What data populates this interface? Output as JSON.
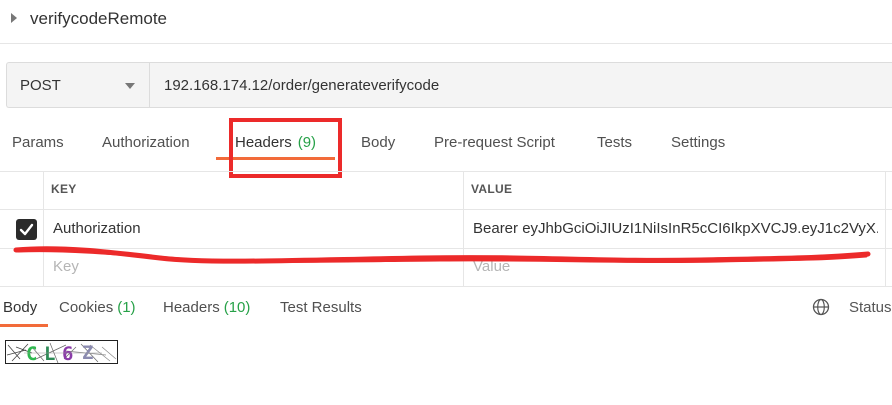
{
  "request": {
    "title": "verifycodeRemote",
    "method": "POST",
    "url": "192.168.174.12/order/generateverifycode"
  },
  "request_tabs": [
    {
      "label": "Params"
    },
    {
      "label": "Authorization"
    },
    {
      "label": "Headers",
      "count": "(9)",
      "active": true
    },
    {
      "label": "Body"
    },
    {
      "label": "Pre-request Script"
    },
    {
      "label": "Tests"
    },
    {
      "label": "Settings"
    }
  ],
  "headers_table": {
    "columns": [
      "KEY",
      "VALUE"
    ],
    "rows": [
      {
        "checked": true,
        "key": "Authorization",
        "value": "Bearer eyJhbGciOiJIUzI1NiIsInR5cCI6IkpXVCJ9.eyJ1c2VyX..."
      }
    ],
    "new_row": {
      "key_placeholder": "Key",
      "value_placeholder": "Value"
    }
  },
  "response_tabs": [
    {
      "label": "Body",
      "active": true
    },
    {
      "label": "Cookies",
      "count": "(1)"
    },
    {
      "label": "Headers",
      "count": "(10)"
    },
    {
      "label": "Test Results"
    }
  ],
  "response": {
    "status_label": "Status:",
    "captcha_text": "CL6Z"
  },
  "icons": {
    "collapse": "caret-right-icon",
    "method_dropdown": "chevron-down-icon",
    "checkbox": "checkbox-checked-icon",
    "network": "globe-icon"
  },
  "colors": {
    "accent": "#f26b3a",
    "count_green": "#27a148",
    "annotation_red": "#ec2a2a"
  }
}
